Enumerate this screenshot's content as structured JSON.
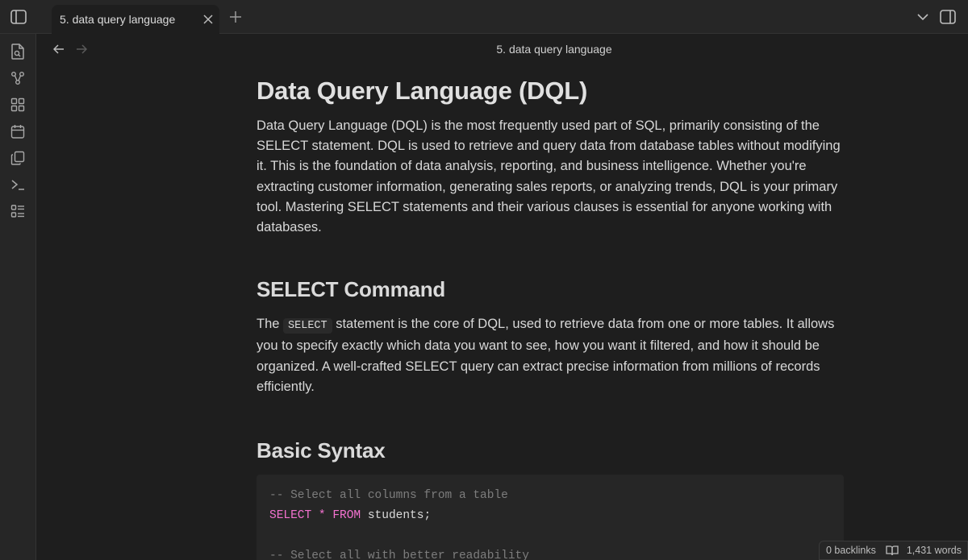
{
  "tab": {
    "title": "5. data query language"
  },
  "view": {
    "title": "5. data query language"
  },
  "note": {
    "heading": "Data Query Language (DQL)",
    "intro": "Data Query Language (DQL) is the most frequently used part of SQL, primarily consisting of the SELECT statement. DQL is used to retrieve and query data from database tables without modifying it. This is the foundation of data analysis, reporting, and business intelligence. Whether you're extracting customer information, generating sales reports, or analyzing trends, DQL is your primary tool. Mastering SELECT statements and their various clauses is essential for anyone working with databases.",
    "section1_heading": "SELECT Command",
    "section1_para_before": "The ",
    "section1_code": "SELECT",
    "section1_para_after": " statement is the core of DQL, used to retrieve data from one or more tables. It allows you to specify exactly which data you want to see, how you want it filtered, and how it should be organized. A well-crafted SELECT query can extract precise information from millions of records efficiently.",
    "section2_heading": "Basic Syntax",
    "code": {
      "line1_comment": "-- Select all columns from a table",
      "line2_kw1": "SELECT",
      "line2_op": "*",
      "line2_kw2": "FROM",
      "line2_ident": "students;",
      "line4_comment": "-- Select all with better readability"
    }
  },
  "status": {
    "backlinks": "0 backlinks",
    "words": "1,431 words"
  },
  "colors": {
    "background": "#1e1e1e",
    "chrome": "#262626",
    "keyword": "#f472d0",
    "comment": "#7d7d7d"
  },
  "icons": {
    "ribbon": [
      "file-search-icon",
      "graph-icon",
      "canvas-icon",
      "calendar-icon",
      "copy-icon",
      "terminal-icon",
      "list-icon"
    ]
  }
}
